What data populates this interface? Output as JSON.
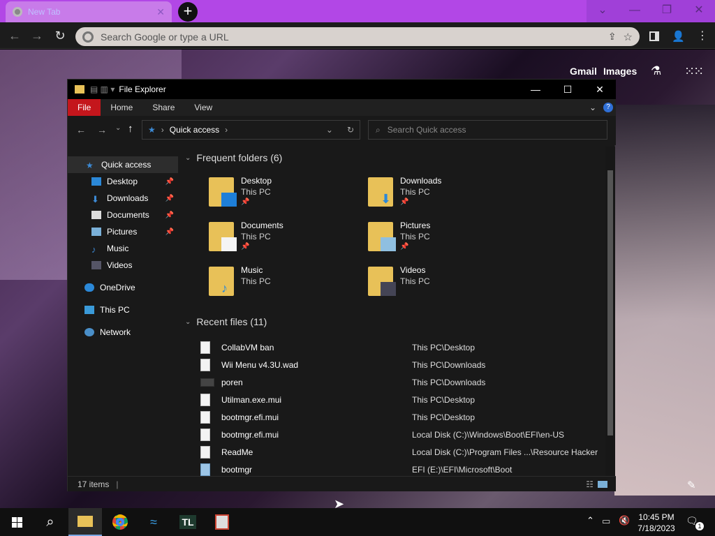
{
  "browser": {
    "tab_title": "New Tab",
    "new_tab_glyph": "+",
    "window_controls": [
      "⌄",
      "—",
      "❐",
      "✕"
    ],
    "omnibox_placeholder": "Search Google or type a URL"
  },
  "newtab_page": {
    "links": [
      "Gmail",
      "Images"
    ]
  },
  "explorer": {
    "title": "File Explorer",
    "ribbon_tabs": [
      "File",
      "Home",
      "Share",
      "View"
    ],
    "address": "Quick access",
    "search_placeholder": "Search Quick access",
    "nav_items": [
      {
        "label": "Quick access",
        "icon": "star-icon",
        "pinned": false
      },
      {
        "label": "Desktop",
        "icon": "desktop-icon",
        "pinned": true
      },
      {
        "label": "Downloads",
        "icon": "download-icon",
        "pinned": true
      },
      {
        "label": "Documents",
        "icon": "document-icon",
        "pinned": true
      },
      {
        "label": "Pictures",
        "icon": "pictures-icon",
        "pinned": true
      },
      {
        "label": "Music",
        "icon": "music-icon",
        "pinned": false
      },
      {
        "label": "Videos",
        "icon": "video-icon",
        "pinned": false
      },
      {
        "label": "OneDrive",
        "icon": "cloud-icon",
        "pinned": false
      },
      {
        "label": "This PC",
        "icon": "computer-icon",
        "pinned": false
      },
      {
        "label": "Network",
        "icon": "network-icon",
        "pinned": false
      }
    ],
    "frequent_header": "Frequent folders (6)",
    "frequent": [
      {
        "name": "Desktop",
        "location": "This PC",
        "pinned": true
      },
      {
        "name": "Downloads",
        "location": "This PC",
        "pinned": true
      },
      {
        "name": "Documents",
        "location": "This PC",
        "pinned": true
      },
      {
        "name": "Pictures",
        "location": "This PC",
        "pinned": true
      },
      {
        "name": "Music",
        "location": "This PC",
        "pinned": false
      },
      {
        "name": "Videos",
        "location": "This PC",
        "pinned": false
      }
    ],
    "recent_header": "Recent files (11)",
    "recent": [
      {
        "name": "CollabVM ban",
        "location": "This PC\\Desktop"
      },
      {
        "name": "Wii Menu v4.3U.wad",
        "location": "This PC\\Downloads"
      },
      {
        "name": "poren",
        "location": "This PC\\Downloads"
      },
      {
        "name": "Utilman.exe.mui",
        "location": "This PC\\Desktop"
      },
      {
        "name": "bootmgr.efi.mui",
        "location": "This PC\\Desktop"
      },
      {
        "name": "bootmgr.efi.mui",
        "location": "Local Disk (C:)\\Windows\\Boot\\EFI\\en-US"
      },
      {
        "name": "ReadMe",
        "location": "Local Disk (C:)\\Program Files ...\\Resource Hacker"
      },
      {
        "name": "bootmgr",
        "location": "EFI (E:)\\EFI\\Microsoft\\Boot"
      }
    ],
    "status": "17 items"
  },
  "taskbar": {
    "time": "10:45 PM",
    "date": "7/18/2023",
    "notification_count": "1",
    "pinned": [
      "start-icon",
      "search-icon",
      "file-explorer-icon",
      "chrome-icon",
      "dolphin-icon",
      "tl-icon",
      "java-icon"
    ],
    "tl_label": "TL"
  },
  "colors": {
    "tabstrip": "#b247e6",
    "file_tab": "#c4161c",
    "folder": "#e8c158"
  }
}
